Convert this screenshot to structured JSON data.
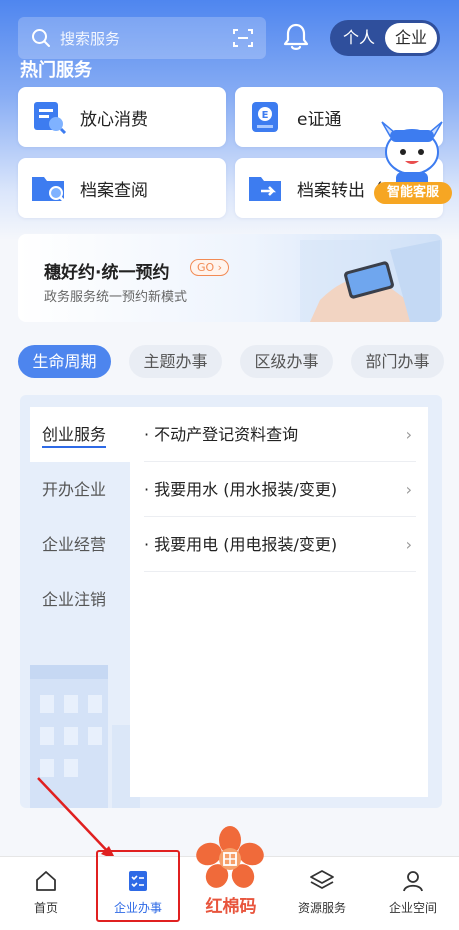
{
  "header": {
    "search_placeholder": "搜索服务",
    "toggle": {
      "personal": "个人",
      "enterprise": "企业"
    }
  },
  "hot_services": {
    "title": "热门服务",
    "items": [
      {
        "label": "放心消费",
        "icon": "consumer-icon"
      },
      {
        "label": "e证通",
        "icon": "e-cert-icon"
      },
      {
        "label": "档案查阅",
        "icon": "archive-search-icon"
      },
      {
        "label": "档案转出（",
        "icon": "archive-transfer-icon"
      }
    ]
  },
  "assistant": {
    "label": "智能客服"
  },
  "banner": {
    "title": "穗好约·统一预约",
    "go": "GO",
    "subtitle": "政务服务统一预约新模式"
  },
  "tabs": [
    "生命周期",
    "主题办事",
    "区级办事",
    "部门办事"
  ],
  "lifecycle": {
    "left": [
      "创业服务",
      "开办企业",
      "企业经营",
      "企业注销"
    ],
    "right": [
      "· 不动产登记资料查询",
      "· 我要用水 (用水报装/变更)",
      "· 我要用电 (用电报装/变更)"
    ]
  },
  "bottom_nav": {
    "home": "首页",
    "enterprise_affairs": "企业办事",
    "center": "红棉码",
    "resources": "资源服务",
    "enterprise_space": "企业空间"
  },
  "colors": {
    "accent": "#2e6ae6",
    "header_gradient_top": "#4f86ef",
    "highlight_box": "#e02020",
    "center_logo": "#f06a3a"
  }
}
